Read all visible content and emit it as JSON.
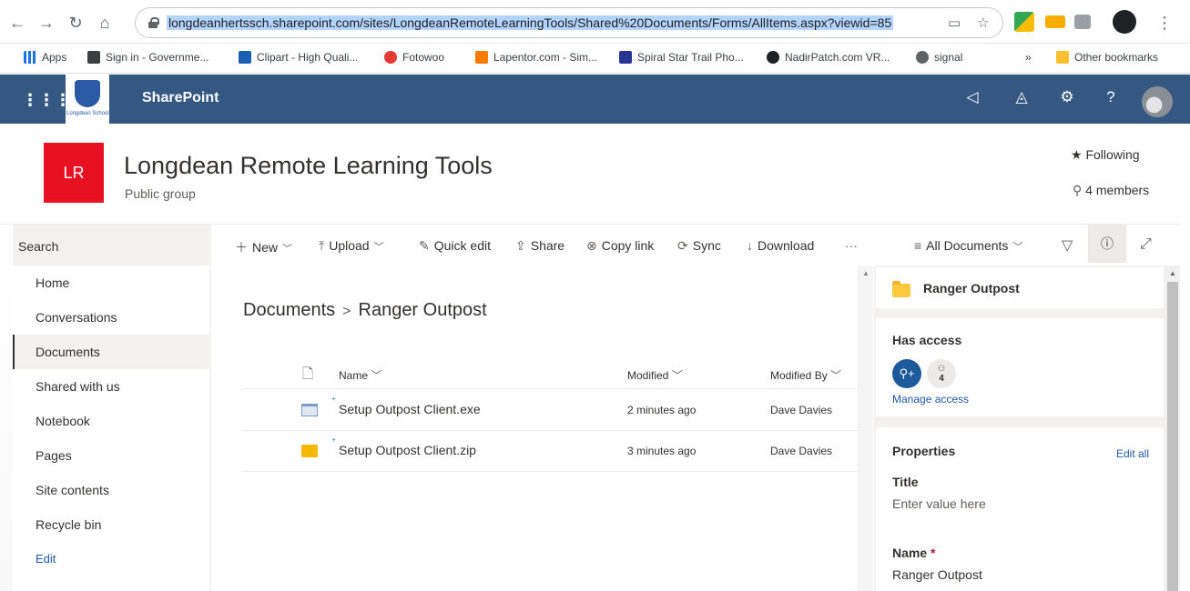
{
  "browser": {
    "url": "longdeanhertssch.sharepoint.com/sites/LongdeanRemoteLearningTools/Shared%20Documents/Forms/AllItems.aspx?viewid=85",
    "bookmarks": [
      {
        "label": "Apps",
        "color": "#1a73e8"
      },
      {
        "label": "Sign in - Governme...",
        "color": "#3c4043"
      },
      {
        "label": "Clipart - High Quali...",
        "color": "#1a5fb4"
      },
      {
        "label": "Fotowoo",
        "color": "#e53935"
      },
      {
        "label": "Lapentor.com - Sim...",
        "color": "#f57c00"
      },
      {
        "label": "Spiral Star Trail Pho...",
        "color": "#283593"
      },
      {
        "label": "NadirPatch.com VR...",
        "color": "#202124"
      },
      {
        "label": "signal",
        "color": "#5f6368"
      }
    ],
    "more_bookmarks": "»",
    "other_bookmarks": "Other bookmarks"
  },
  "suite": {
    "brand": "SharePoint",
    "logo_text": "Longdean School"
  },
  "site": {
    "logo_initials": "LR",
    "title": "Longdean Remote Learning Tools",
    "subtitle": "Public group",
    "following": "Following",
    "members": "4 members",
    "logo_color": "#e81123"
  },
  "commands": {
    "search_label": "Search",
    "new": "New",
    "upload": "Upload",
    "quick_edit": "Quick edit",
    "share": "Share",
    "copy_link": "Copy link",
    "sync": "Sync",
    "download": "Download",
    "more": "···",
    "view": "All Documents"
  },
  "nav": {
    "items": [
      "Home",
      "Conversations",
      "Documents",
      "Shared with us",
      "Notebook",
      "Pages",
      "Site contents",
      "Recycle bin"
    ],
    "active_index": 2,
    "edit_label": "Edit"
  },
  "library": {
    "breadcrumb_root": "Documents",
    "breadcrumb_current": "Ranger Outpost",
    "columns": {
      "name": "Name",
      "modified": "Modified",
      "modified_by": "Modified By"
    },
    "rows": [
      {
        "name": "Setup Outpost Client.exe",
        "modified": "2 minutes ago",
        "modified_by": "Dave Davies",
        "icon": "exe-file-icon"
      },
      {
        "name": "Setup Outpost Client.zip",
        "modified": "3 minutes ago",
        "modified_by": "Dave Davies",
        "icon": "zip-file-icon"
      }
    ]
  },
  "details": {
    "folder_name": "Ranger Outpost",
    "has_access": "Has access",
    "members_count": "4",
    "manage_access": "Manage access",
    "properties": "Properties",
    "edit_all": "Edit all",
    "title_label": "Title",
    "title_placeholder": "Enter value here",
    "name_label": "Name",
    "name_required": "*",
    "name_value": "Ranger Outpost"
  }
}
